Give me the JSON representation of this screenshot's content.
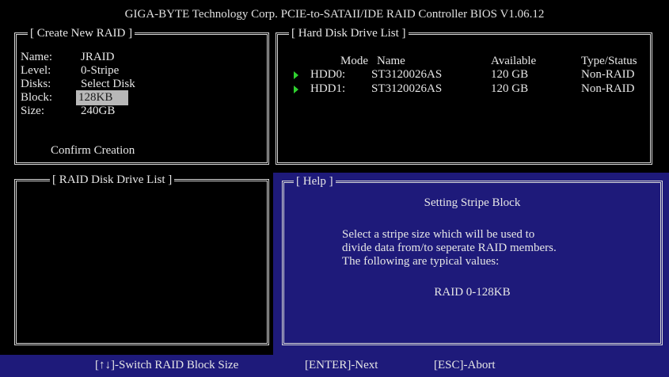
{
  "header": {
    "title": "GIGA-BYTE Technology Corp. PCIE-to-SATAII/IDE RAID Controller BIOS V1.06.12"
  },
  "create_raid": {
    "title": "[ Create New RAID ]",
    "fields": [
      {
        "label": "Name:",
        "value": "JRAID"
      },
      {
        "label": "Level:",
        "value": "0-Stripe"
      },
      {
        "label": "Disks:",
        "value": "Select Disk"
      },
      {
        "label": "Block:",
        "value": "128KB"
      },
      {
        "label": "Size:",
        "value": "240GB"
      }
    ],
    "confirm_label": "Confirm Creation"
  },
  "hdd_list": {
    "title": "[ Hard Disk Drive List ]",
    "columns": {
      "mode": "Mode",
      "name": "Name",
      "available": "Available",
      "type": "Type/Status"
    },
    "rows": [
      {
        "id": "HDD0:",
        "name": "ST3120026AS",
        "available": "120 GB",
        "type": "Non-RAID"
      },
      {
        "id": "HDD1:",
        "name": "ST3120026AS",
        "available": "120 GB",
        "type": "Non-RAID"
      }
    ]
  },
  "raid_list": {
    "title": "[ RAID Disk Drive List ]"
  },
  "help": {
    "title": "[ Help ]",
    "heading": "Setting Stripe Block",
    "lines": [
      "Select a stripe size which will be used to",
      "divide data from/to seperate RAID members.",
      "The following are typical values:"
    ],
    "value": "RAID 0-128KB"
  },
  "status_bar": {
    "switch": "[↑↓]-Switch RAID Block Size",
    "next": "[ENTER]-Next",
    "abort": "[ESC]-Abort"
  },
  "colors": {
    "panel_blue": "#1e1a7a",
    "highlight": "#b8b8b8",
    "arrow_green": "#2fd12f"
  }
}
